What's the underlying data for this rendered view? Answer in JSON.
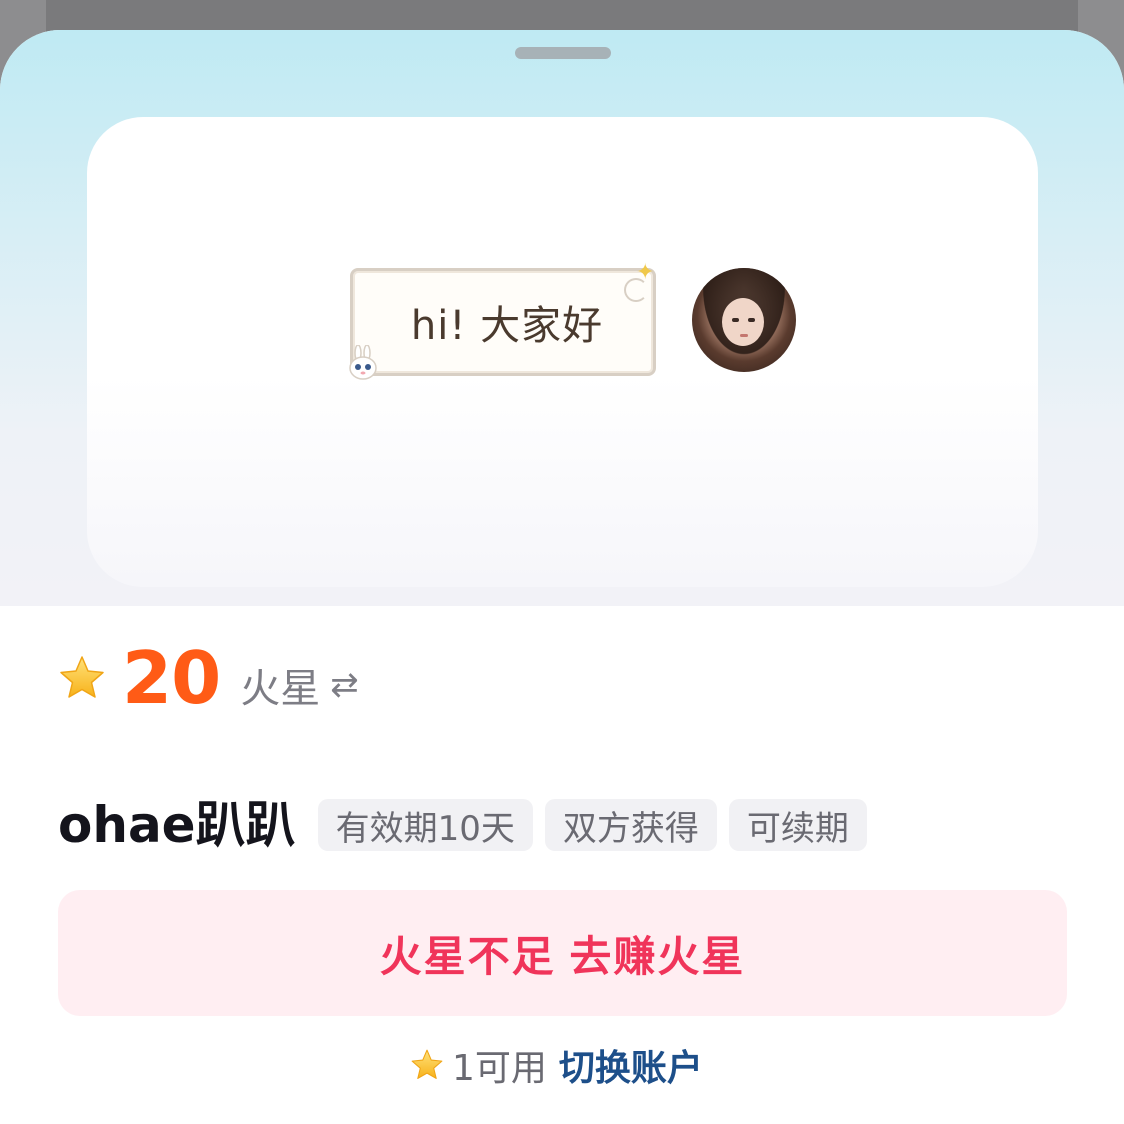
{
  "preview": {
    "bubble_text": "hi! 大家好"
  },
  "price": {
    "value": "20",
    "currency": "火星",
    "swap_symbol": "⇄"
  },
  "item": {
    "name": "ohae趴趴",
    "tags": [
      "有效期10天",
      "双方获得",
      "可续期"
    ]
  },
  "primary_button": {
    "label": "火星不足 去赚火星"
  },
  "footer": {
    "available": "1可用",
    "switch_account": "切换账户"
  },
  "colors": {
    "price": "#ff5b16",
    "button_text": "#f0345a",
    "button_bg": "#ffeef2",
    "link": "#1d4f8a"
  },
  "icons": {
    "star": "star-icon",
    "swap": "swap-icon",
    "sparkle": "sparkle-icon",
    "bunny": "bunny-icon"
  }
}
